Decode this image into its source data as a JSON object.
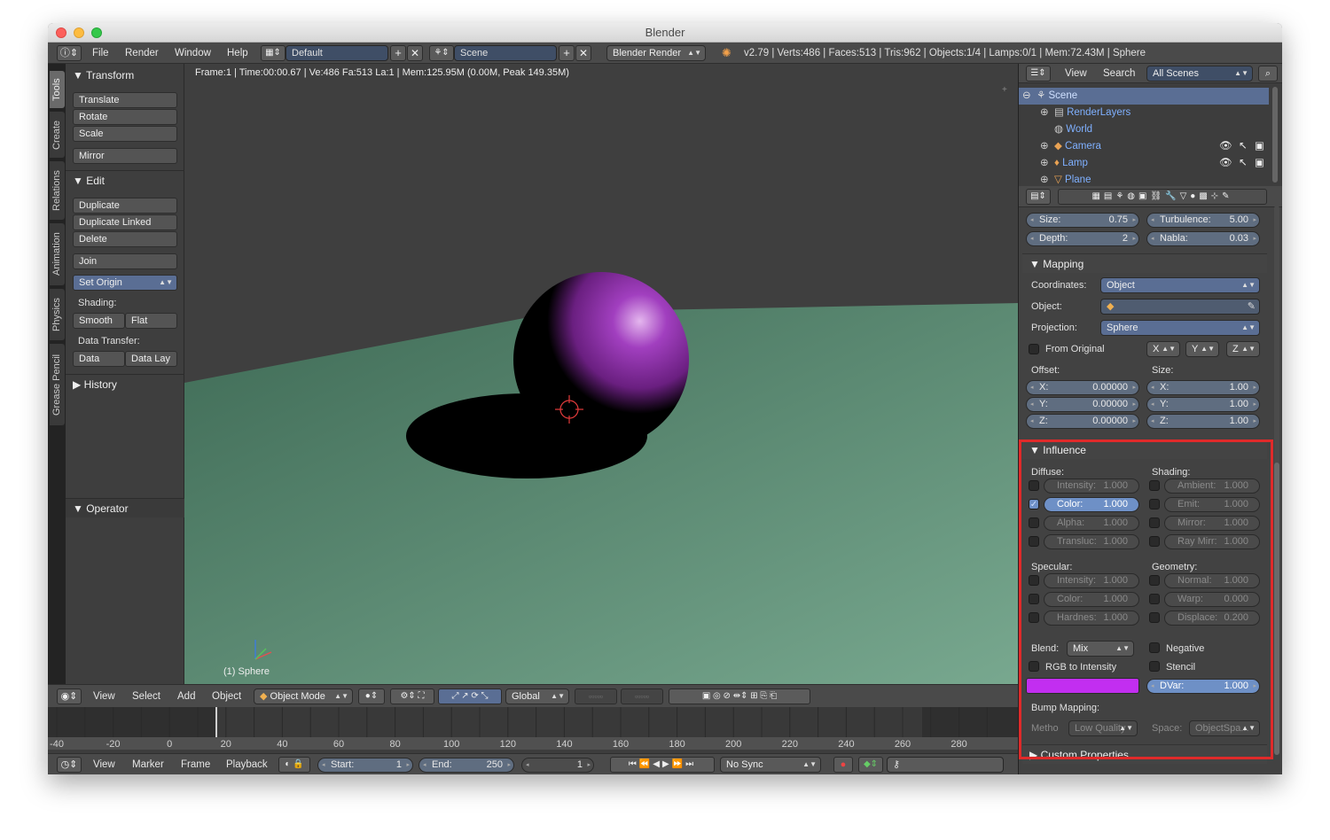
{
  "window": {
    "title": "Blender"
  },
  "menubar": {
    "items": [
      "File",
      "Render",
      "Window",
      "Help"
    ],
    "screen_layout": "Default",
    "scene": "Scene",
    "render_engine": "Blender Render",
    "stats": "v2.79 | Verts:486 | Faces:513 | Tris:962 | Objects:1/4 | Lamps:0/1 | Mem:72.43M | Sphere"
  },
  "tool_tabs": [
    "Tools",
    "Create",
    "Relations",
    "Animation",
    "Physics",
    "Grease Pencil"
  ],
  "tool_shelf": {
    "transform_title": "Transform",
    "transform": [
      "Translate",
      "Rotate",
      "Scale",
      "Mirror"
    ],
    "edit_title": "Edit",
    "edit": [
      "Duplicate",
      "Duplicate Linked",
      "Delete",
      "Join"
    ],
    "set_origin": "Set Origin",
    "shading_label": "Shading:",
    "smooth": "Smooth",
    "flat": "Flat",
    "data_transfer_label": "Data Transfer:",
    "data": "Data",
    "data_lay": "Data Lay",
    "history_title": "History",
    "operator_title": "Operator"
  },
  "viewport": {
    "info": "Frame:1 | Time:00:00.67 | Ve:486 Fa:513 La:1 | Mem:125.95M (0.00M, Peak 149.35M)",
    "object_label": "(1) Sphere",
    "colors": {
      "floor": "#5f8f77",
      "sphere": "#8a2fa0",
      "background": "#3f3f3f"
    }
  },
  "viewport_header": {
    "menus": [
      "View",
      "Select",
      "Add",
      "Object"
    ],
    "mode": "Object Mode",
    "orientation": "Global"
  },
  "timeline": {
    "ticks": [
      "-40",
      "-20",
      "0",
      "20",
      "40",
      "60",
      "80",
      "100",
      "120",
      "140",
      "160",
      "180",
      "200",
      "220",
      "240",
      "260",
      "280"
    ],
    "menus": [
      "View",
      "Marker",
      "Frame",
      "Playback"
    ],
    "start_label": "Start:",
    "start": "1",
    "end_label": "End:",
    "end": "250",
    "current": "1",
    "sync": "No Sync"
  },
  "outliner": {
    "menus": [
      "View",
      "Search"
    ],
    "filter": "All Scenes",
    "rows": [
      "Scene",
      "RenderLayers",
      "World",
      "Camera",
      "Lamp",
      "Plane"
    ]
  },
  "texture_props": {
    "size_label": "Size:",
    "size": "0.75",
    "turbulence_label": "Turbulence:",
    "turbulence": "5.00",
    "depth_label": "Depth:",
    "depth": "2",
    "nabla_label": "Nabla:",
    "nabla": "0.03"
  },
  "mapping": {
    "title": "Mapping",
    "coordinates_label": "Coordinates:",
    "coordinates": "Object",
    "object_label": "Object:",
    "projection_label": "Projection:",
    "projection": "Sphere",
    "from_original": "From Original",
    "axes": [
      "X",
      "Y",
      "Z"
    ],
    "offset_label": "Offset:",
    "size_label": "Size:",
    "offset": [
      {
        "k": "X:",
        "v": "0.00000"
      },
      {
        "k": "Y:",
        "v": "0.00000"
      },
      {
        "k": "Z:",
        "v": "0.00000"
      }
    ],
    "size": [
      {
        "k": "X:",
        "v": "1.00"
      },
      {
        "k": "Y:",
        "v": "1.00"
      },
      {
        "k": "Z:",
        "v": "1.00"
      }
    ]
  },
  "influence": {
    "title": "Influence",
    "diffuse_label": "Diffuse:",
    "shading_label": "Shading:",
    "specular_label": "Specular:",
    "geometry_label": "Geometry:",
    "diffuse": [
      {
        "k": "Intensity:",
        "v": "1.000",
        "on": false
      },
      {
        "k": "Color:",
        "v": "1.000",
        "on": true
      },
      {
        "k": "Alpha:",
        "v": "1.000",
        "on": false
      },
      {
        "k": "Transluc:",
        "v": "1.000",
        "on": false
      }
    ],
    "shading": [
      {
        "k": "Ambient:",
        "v": "1.000"
      },
      {
        "k": "Emit:",
        "v": "1.000"
      },
      {
        "k": "Mirror:",
        "v": "1.000"
      },
      {
        "k": "Ray Mirr:",
        "v": "1.000"
      }
    ],
    "specular": [
      {
        "k": "Intensity:",
        "v": "1.000"
      },
      {
        "k": "Color:",
        "v": "1.000"
      },
      {
        "k": "Hardnes:",
        "v": "1.000"
      }
    ],
    "geometry": [
      {
        "k": "Normal:",
        "v": "1.000"
      },
      {
        "k": "Warp:",
        "v": "0.000"
      },
      {
        "k": "Displace:",
        "v": "0.200"
      }
    ],
    "blend_label": "Blend:",
    "blend": "Mix",
    "negative": "Negative",
    "rgb_to_intensity": "RGB to Intensity",
    "stencil": "Stencil",
    "color": "#c22ef0",
    "dvar_label": "DVar:",
    "dvar": "1.000",
    "bump_label": "Bump Mapping:",
    "method_label": "Metho",
    "method": "Low Quality",
    "space_label": "Space:",
    "space": "ObjectSpa..."
  },
  "custom_properties": "Custom Properties",
  "highlight_color": "#e02a2a"
}
